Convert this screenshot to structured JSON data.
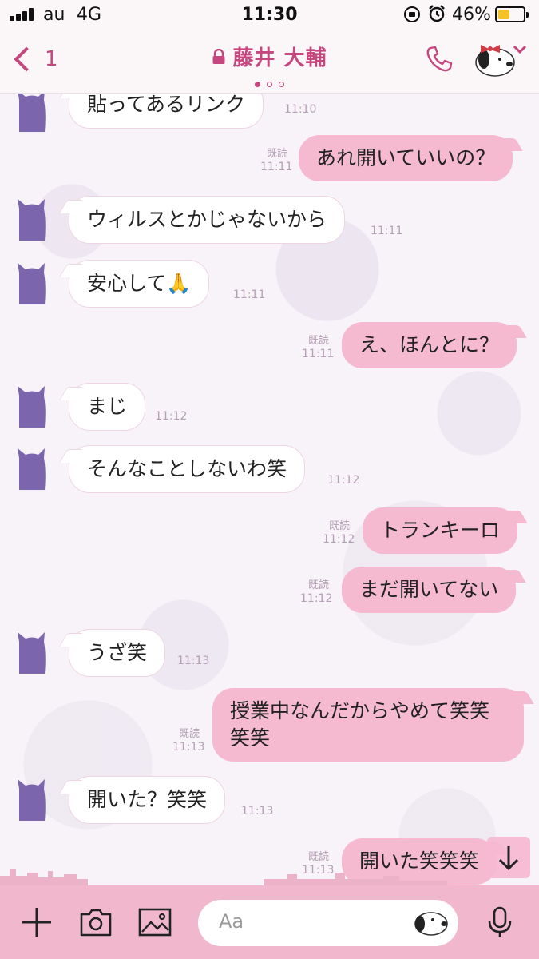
{
  "status_bar": {
    "carrier": "au",
    "network": "4G",
    "time": "11:30",
    "battery": "46%",
    "battery_level": 0.46
  },
  "header": {
    "back_count": "1",
    "title": "藤井 大輔",
    "page_indicator": {
      "count": 3,
      "active": 0
    }
  },
  "messages": [
    {
      "side": "in",
      "text": "貼ってあるリンク",
      "time": "11:10"
    },
    {
      "side": "out",
      "text": "あれ開いていいの？",
      "read": "既読",
      "time": "11:11"
    },
    {
      "side": "in",
      "text": "ウィルスとかじゃないから",
      "time": "11:11"
    },
    {
      "side": "in",
      "text": "安心して🙏",
      "time": "11:11"
    },
    {
      "side": "out",
      "text": "え、ほんとに？",
      "read": "既読",
      "time": "11:11"
    },
    {
      "side": "in",
      "text": "まじ",
      "time": "11:12"
    },
    {
      "side": "in",
      "text": "そんなことしないわ笑",
      "time": "11:12"
    },
    {
      "side": "out",
      "text": "トランキーロ",
      "read": "既読",
      "time": "11:12"
    },
    {
      "side": "out",
      "text": "まだ開いてない",
      "read": "既読",
      "time": "11:12"
    },
    {
      "side": "in",
      "text": "うざ笑",
      "time": "11:13"
    },
    {
      "side": "out",
      "text": "授業中なんだからやめて笑笑笑笑",
      "read": "既読",
      "time": "11:13"
    },
    {
      "side": "in",
      "text": "開いた？笑笑",
      "time": "11:13"
    },
    {
      "side": "out",
      "text": "開いた笑笑笑",
      "read": "既読",
      "time": "11:13"
    }
  ],
  "input": {
    "placeholder": "Aa"
  },
  "colors": {
    "accent": "#c6467e",
    "bubble_out": "#f5b9d0",
    "input_bar": "#f1b8cd"
  },
  "icons": [
    "back-chevron-icon",
    "lock-icon",
    "phone-icon",
    "menu-chevron-icon",
    "plus-icon",
    "camera-icon",
    "image-icon",
    "sticker-icon",
    "mic-icon",
    "scroll-down-arrow-icon"
  ]
}
